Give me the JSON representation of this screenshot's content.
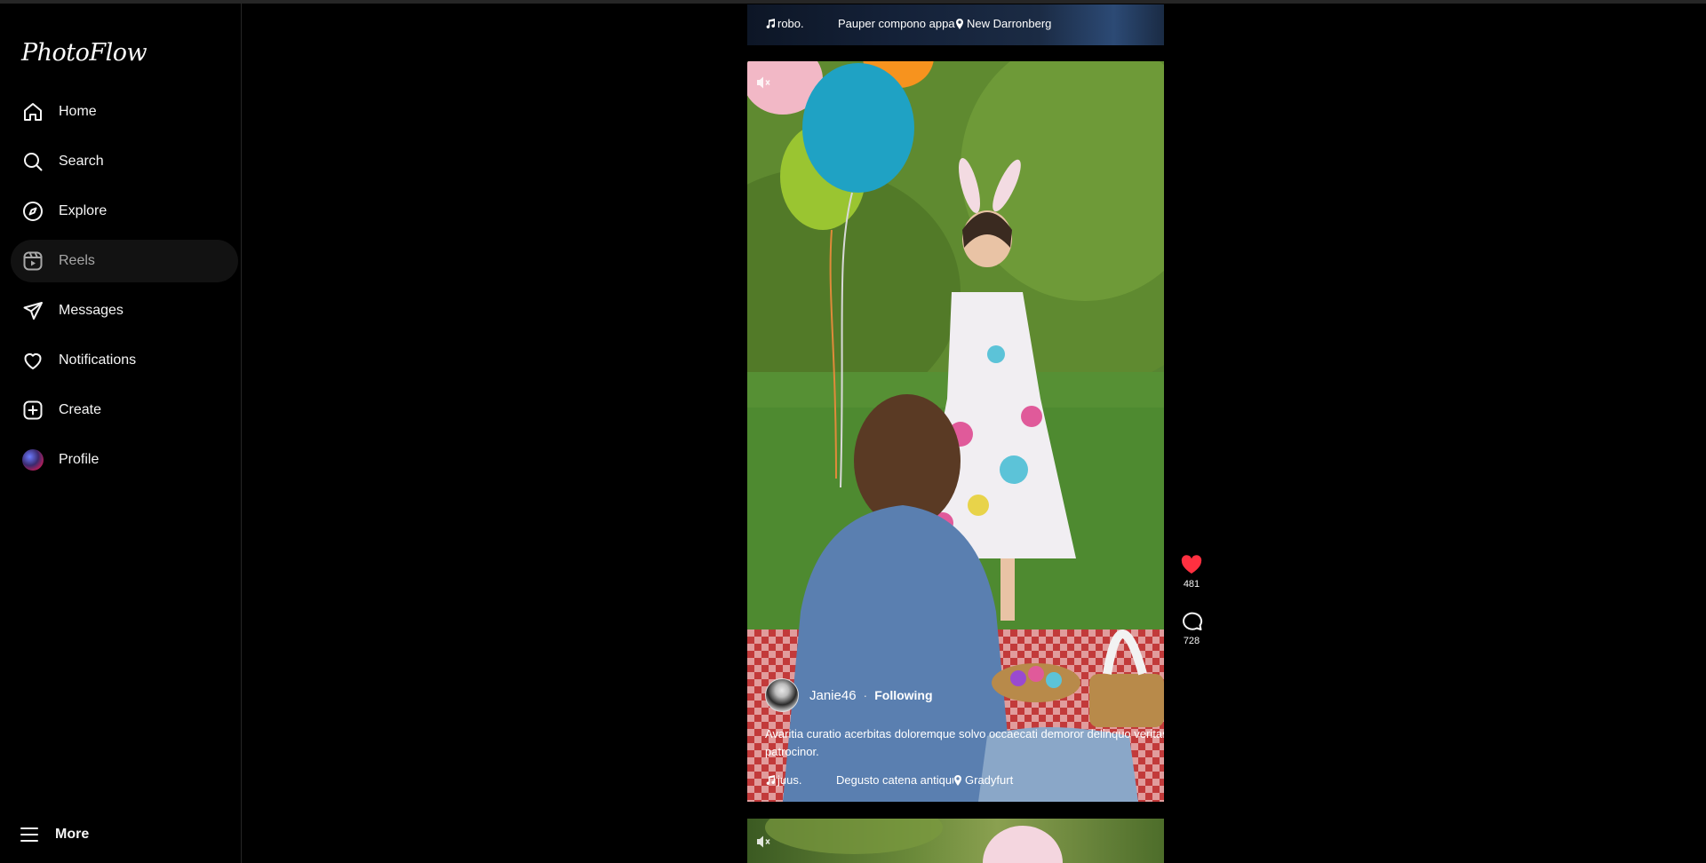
{
  "app": {
    "name": "PhotoFlow"
  },
  "sidebar": {
    "items": [
      {
        "label": "Home",
        "icon": "home-icon"
      },
      {
        "label": "Search",
        "icon": "search-icon"
      },
      {
        "label": "Explore",
        "icon": "compass-icon"
      },
      {
        "label": "Reels",
        "icon": "reels-icon",
        "active": true
      },
      {
        "label": "Messages",
        "icon": "send-icon"
      },
      {
        "label": "Notifications",
        "icon": "heart-icon"
      },
      {
        "label": "Create",
        "icon": "plus-square-icon"
      },
      {
        "label": "Profile",
        "icon": "avatar"
      }
    ],
    "more_label": "More"
  },
  "reels": {
    "previous": {
      "audio": "robo.",
      "track": "Pauper compono apparatus",
      "location": "New Darronberg"
    },
    "current": {
      "author": "Janie46",
      "follow_status": "Following",
      "caption": "Avaritia curatio acerbitas doloremque solvo occaecati demoror delinquo veritas patrocinor.",
      "audio": "juus.",
      "track": "Degusto catena antiquus",
      "location": "Gradyfurt",
      "likes": "481",
      "comments": "728",
      "liked": true
    }
  },
  "colors": {
    "background": "#000000",
    "like": "#ff3040",
    "text": "#f5f5f5"
  }
}
